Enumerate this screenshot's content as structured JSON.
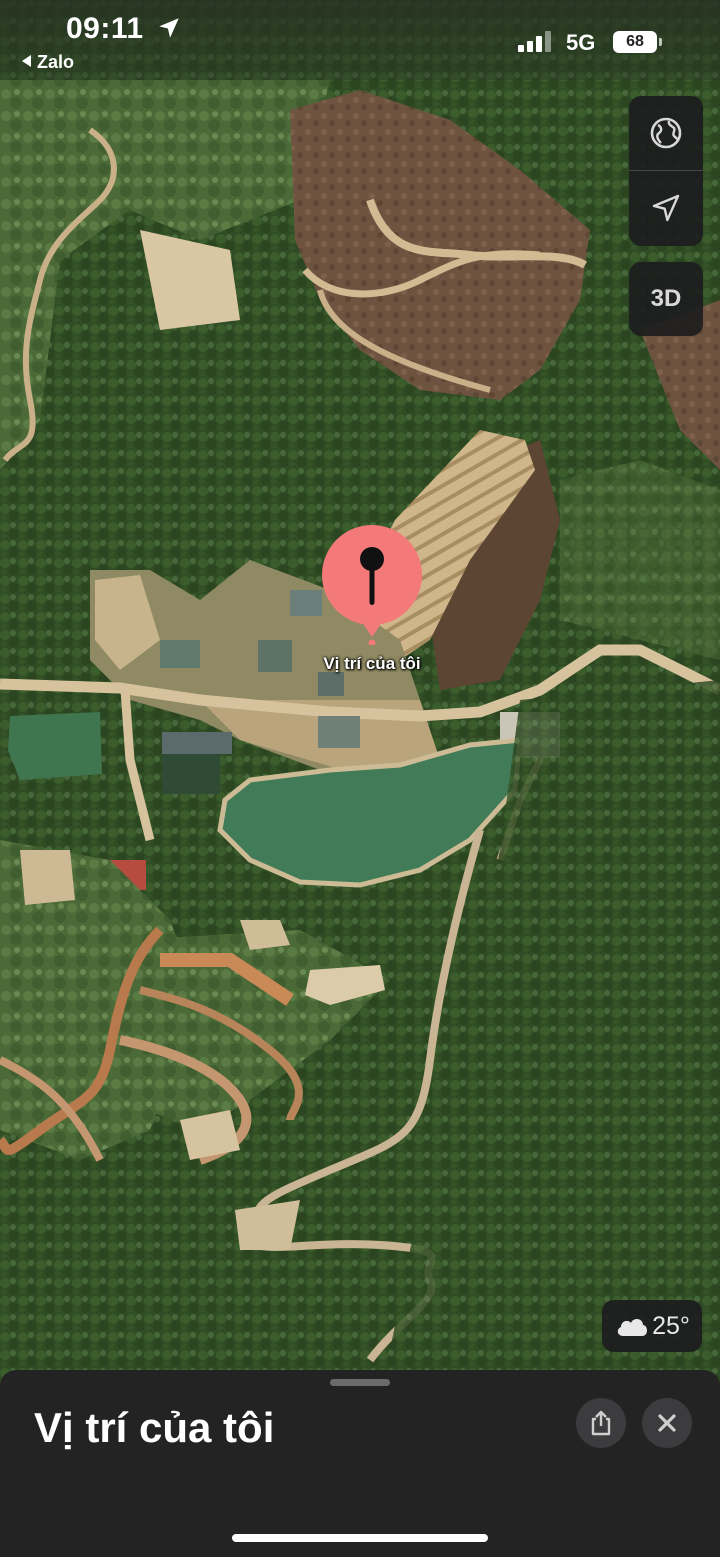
{
  "status_bar": {
    "time": "09:11",
    "back_app": "Zalo",
    "network": "5G",
    "battery": "68"
  },
  "map": {
    "type": "satellite",
    "controls": {
      "globe_icon": "globe-icon",
      "location_icon": "location-arrow-icon",
      "view_3d_label": "3D"
    },
    "pin_label": "Vị trí của tôi",
    "weather": {
      "icon": "cloud-icon",
      "temperature": "25°"
    }
  },
  "sheet": {
    "title": "Vị trí của tôi",
    "share_icon": "share-icon",
    "close_icon": "close-icon"
  },
  "colors": {
    "pin": "#f47a7a",
    "sheet_bg": "#232323",
    "control_bg": "#1c1c1e",
    "forest": "#2f4a24",
    "water": "#3f7a55",
    "dirt": "#c9b088"
  }
}
